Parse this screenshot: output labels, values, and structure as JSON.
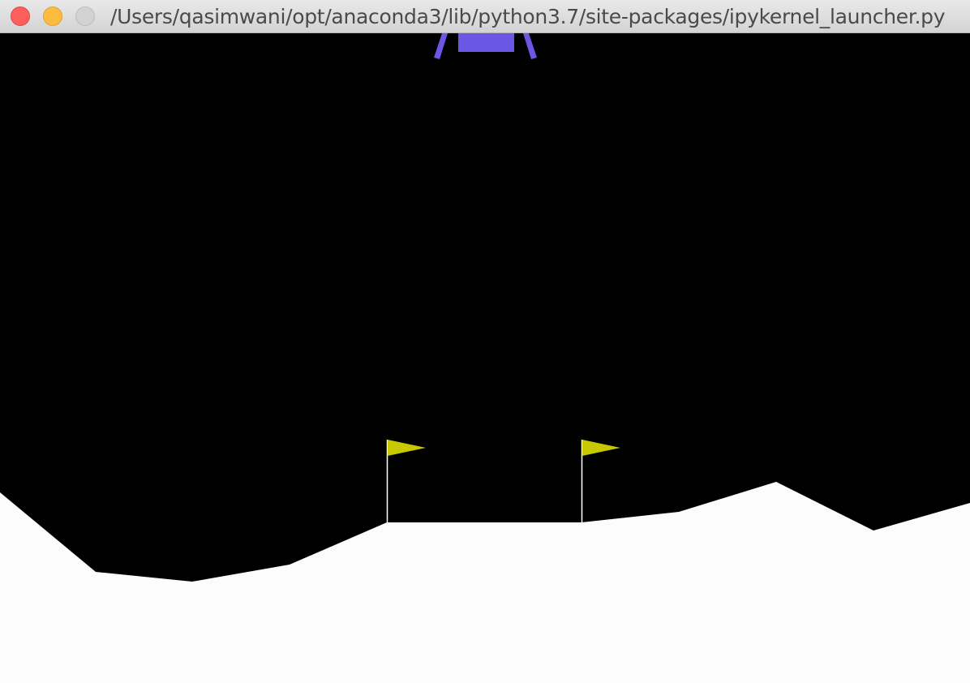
{
  "window": {
    "title": "/Users/qasimwani/opt/anaconda3/lib/python3.7/site-packages/ipykernel_launcher.py"
  },
  "scene": {
    "game": "lunar-lander",
    "colors": {
      "sky": "#000000",
      "terrain": "#fcfcfc",
      "lander": "#6b57e6",
      "flag": "#c8c800",
      "flag_pole": "#ffffff"
    }
  }
}
